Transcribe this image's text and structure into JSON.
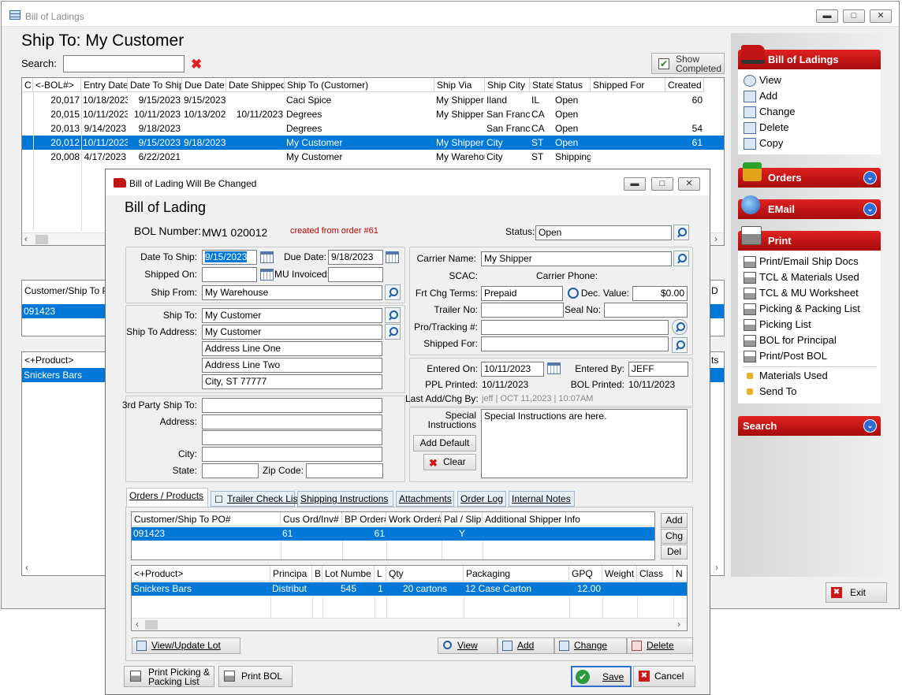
{
  "main_window": {
    "title": "Bill of Ladings",
    "heading": "Ship To: My Customer",
    "search_label": "Search:",
    "search_value": "",
    "show_completed": "Show\nCompleted"
  },
  "list": {
    "columns": [
      "C",
      "<-BOL#>",
      "Entry Date",
      "Date To Ship",
      "Due Date",
      "Date Shipped",
      "Ship To (Customer)",
      "Ship Via",
      "Ship City",
      "State",
      "Status",
      "Shipped For",
      "Created F"
    ],
    "rows": [
      [
        "",
        "20,017",
        "10/18/2023",
        "9/15/2023",
        "9/15/2023",
        "",
        "Caci Spice",
        "My Shipper",
        "Iland",
        "IL",
        "Open",
        "",
        "60"
      ],
      [
        "",
        "20,015",
        "10/11/2023",
        "10/11/2023",
        "10/13/2023",
        "10/11/2023",
        "Degrees",
        "My Shipper",
        "San Francis",
        "CA",
        "Open",
        "",
        ""
      ],
      [
        "",
        "20,013",
        "9/14/2023",
        "9/18/2023",
        "",
        "",
        "Degrees",
        "",
        "San Francis",
        "CA",
        "Open",
        "",
        "54"
      ],
      [
        "",
        "20,012",
        "10/11/2023",
        "9/15/2023",
        "9/18/2023",
        "",
        "My Customer",
        "My Shipper",
        "City",
        "ST",
        "Open",
        "",
        "61"
      ],
      [
        "",
        "20,008",
        "4/17/2023",
        "6/22/2021",
        "",
        "",
        "My Customer",
        "My Warehou",
        "City",
        "ST",
        "Shipping",
        "",
        ""
      ]
    ]
  },
  "bg_sub1": {
    "header": "Customer/Ship To PO",
    "value": "091423",
    "right_hdr_a": "nt",
    "right_hdr_b": "D"
  },
  "bg_sub2": {
    "header": "<+Product>",
    "value": "Snickers Bars",
    "right_hdr": "ts"
  },
  "sidebar": {
    "bol_title": "Bill of Ladings",
    "bol_items": [
      "View",
      "Add",
      "Change",
      "Delete",
      "Copy"
    ],
    "orders": "Orders",
    "email": "EMail",
    "print": "Print",
    "print_items": [
      "Print/Email Ship Docs",
      "TCL & Materials Used",
      "TCL & MU Worksheet",
      "Picking & Packing List",
      "Picking List",
      "BOL for Principal",
      "Print/Post BOL",
      "Materials Used",
      "Send To"
    ],
    "search": "Search",
    "exit": "Exit"
  },
  "dialog": {
    "title": "Bill of Lading Will Be Changed",
    "heading": "Bill of Lading",
    "bol_label": "BOL Number:",
    "bol_value": "MW1 020012",
    "created_from": "created from order #61",
    "status_label": "Status:",
    "status_value": "Open",
    "date_to_ship_label": "Date To Ship:",
    "date_to_ship": "9/15/2023",
    "due_date_label": "Due Date:",
    "due_date": "9/18/2023",
    "shipped_on_label": "Shipped On:",
    "shipped_on": "",
    "mu_invoiced_label": "MU Invoiced:",
    "mu_invoiced": "",
    "ship_from_label": "Ship From:",
    "ship_from": "My Warehouse",
    "ship_to_label": "Ship To:",
    "ship_to": "My Customer",
    "ship_to_address_label": "Ship To Address:",
    "addr": [
      "My Customer",
      "Address Line One",
      "Address Line Two",
      "City, ST 77777"
    ],
    "third_party_label": "3rd Party Ship To:",
    "address_label": "Address:",
    "city_label": "City:",
    "state_label": "State:",
    "zip_label": "Zip Code:",
    "carrier_label": "Carrier Name:",
    "carrier": "My Shipper",
    "scac_label": "SCAC:",
    "carrier_phone_label": "Carrier Phone:",
    "frt_label": "Frt Chg Terms:",
    "frt": "Prepaid",
    "dec_label": "Dec. Value:",
    "dec": "$0.00",
    "trailer_label": "Trailer No:",
    "seal_label": "Seal No:",
    "pro_label": "Pro/Tracking #:",
    "shipped_for_label": "Shipped For:",
    "entered_on_label": "Entered On:",
    "entered_on": "10/11/2023",
    "entered_by_label": "Entered By:",
    "entered_by": "JEFF",
    "ppl_label": "PPL Printed:",
    "ppl": "10/11/2023",
    "bol_printed_label": "BOL Printed:",
    "bol_printed": "10/11/2023",
    "last_label": "Last Add/Chg By:",
    "last": "jeff | OCT 11,2023 | 10:07AM",
    "special_label": "Special\nInstructions",
    "special": "Special Instructions are here.",
    "add_default": "Add Default",
    "clear": "Clear",
    "tabs": [
      "Orders / Products",
      "Trailer Check List",
      "Shipping Instructions",
      "Attachments",
      "Order Log",
      "Internal Notes"
    ],
    "orders_grid": {
      "columns": [
        "Customer/Ship To PO#",
        "Cus Ord/Inv#",
        "BP Order#",
        "Work Order#",
        "Pal / Slip",
        "Additional Shipper Info"
      ],
      "row": [
        "091423",
        "61",
        "61",
        "",
        "Y",
        ""
      ]
    },
    "side_btns": [
      "Add",
      "Chg",
      "Del"
    ],
    "products_grid": {
      "columns": [
        "<+Product>",
        "Principa",
        "B",
        "Lot Numbe",
        "L",
        "Qty",
        "Packaging",
        "GPQ",
        "Weight",
        "Class",
        "N"
      ],
      "row": [
        "Snickers Bars",
        "Distribut",
        "",
        "545",
        "1",
        "20 cartons",
        "12 Case Carton",
        "12.00",
        "",
        "",
        ""
      ]
    },
    "bottom_btns": {
      "view_lot": "View/Update Lot",
      "view": "View",
      "add": "Add",
      "change": "Change",
      "delete": "Delete",
      "print_picking": "Print Picking &\nPacking List",
      "print_bol": "Print BOL",
      "save": "Save",
      "cancel": "Cancel"
    }
  }
}
